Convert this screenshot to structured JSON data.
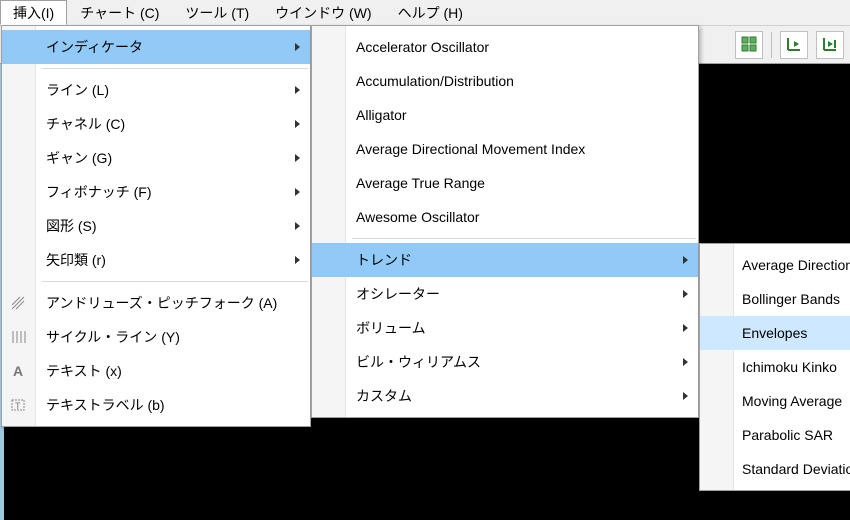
{
  "menubar": {
    "items": [
      {
        "label": "挿入(I)"
      },
      {
        "label": "チャート (C)"
      },
      {
        "label": "ツール (T)"
      },
      {
        "label": "ウインドウ (W)"
      },
      {
        "label": "ヘルプ (H)"
      }
    ],
    "open_index": 0
  },
  "menu1": {
    "items": [
      {
        "label": "インディケータ",
        "arrow": true,
        "highlight": true
      },
      {
        "sep": true
      },
      {
        "label": "ライン (L)",
        "arrow": true
      },
      {
        "label": "チャネル (C)",
        "arrow": true
      },
      {
        "label": "ギャン (G)",
        "arrow": true
      },
      {
        "label": "フィボナッチ (F)",
        "arrow": true
      },
      {
        "label": "図形 (S)",
        "arrow": true
      },
      {
        "label": "矢印類 (r)",
        "arrow": true
      },
      {
        "sep": true
      },
      {
        "label": "アンドリューズ・ピッチフォーク (A)",
        "icon": "pitchfork-icon"
      },
      {
        "label": "サイクル・ライン (Y)",
        "icon": "cycle-lines-icon"
      },
      {
        "label": "テキスト (x)",
        "icon": "text-icon"
      },
      {
        "label": "テキストラベル (b)",
        "icon": "text-label-icon"
      }
    ]
  },
  "menu2": {
    "items": [
      {
        "label": "Accelerator Oscillator"
      },
      {
        "label": "Accumulation/Distribution"
      },
      {
        "label": "Alligator"
      },
      {
        "label": "Average Directional Movement Index"
      },
      {
        "label": "Average True Range"
      },
      {
        "label": "Awesome Oscillator"
      },
      {
        "sep": true
      },
      {
        "label": "トレンド",
        "arrow": true,
        "highlight": true
      },
      {
        "label": "オシレーター",
        "arrow": true
      },
      {
        "label": "ボリューム",
        "arrow": true
      },
      {
        "label": "ビル・ウィリアムス",
        "arrow": true
      },
      {
        "label": "カスタム",
        "arrow": true
      }
    ]
  },
  "menu3": {
    "items": [
      {
        "label": "Average Directional"
      },
      {
        "label": "Bollinger Bands"
      },
      {
        "label": "Envelopes",
        "highlight": true
      },
      {
        "label": "Ichimoku Kinko"
      },
      {
        "label": "Moving Average"
      },
      {
        "label": "Parabolic SAR"
      },
      {
        "label": "Standard Deviation"
      }
    ]
  },
  "toolbar": {
    "icons": [
      "window-tile-icon",
      "chart-shift-icon",
      "chart-shift-end-icon"
    ]
  }
}
